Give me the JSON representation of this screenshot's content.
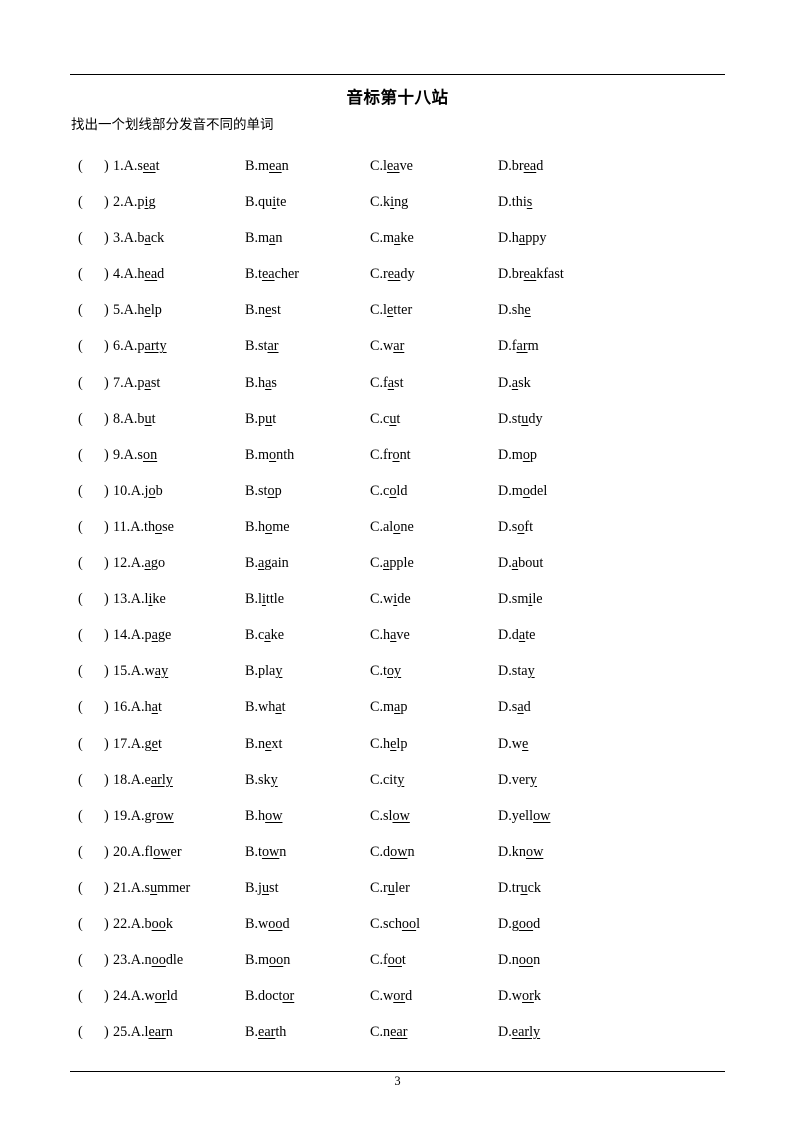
{
  "document": {
    "title": "音标第十八站",
    "instruction": "找出一个划线部分发音不同的单词",
    "page_number": "3",
    "paren_open": "(",
    "paren_close": ")"
  },
  "questions": [
    {
      "number": "1.",
      "options": [
        {
          "letter": "A.",
          "pre": "s",
          "mid": "ea",
          "post": "t"
        },
        {
          "letter": "B.",
          "pre": "m",
          "mid": "ea",
          "post": "n"
        },
        {
          "letter": "C.",
          "pre": "l",
          "mid": "ea",
          "post": "ve"
        },
        {
          "letter": "D.",
          "pre": "br",
          "mid": "ea",
          "post": "d"
        }
      ]
    },
    {
      "number": "2.",
      "options": [
        {
          "letter": "A.",
          "pre": "p",
          "mid": "i",
          "post": "g"
        },
        {
          "letter": "B.",
          "pre": "qu",
          "mid": "i",
          "post": "te"
        },
        {
          "letter": "C.",
          "pre": "k",
          "mid": "i",
          "post": "ng"
        },
        {
          "letter": "D.",
          "pre": "thi",
          "mid": "s",
          "post": ""
        }
      ]
    },
    {
      "number": "3.",
      "options": [
        {
          "letter": "A.",
          "pre": "b",
          "mid": "a",
          "post": "ck"
        },
        {
          "letter": "B.",
          "pre": "m",
          "mid": "a",
          "post": "n"
        },
        {
          "letter": "C.",
          "pre": "m",
          "mid": "a",
          "post": "ke"
        },
        {
          "letter": "D.",
          "pre": "h",
          "mid": "a",
          "post": "ppy"
        }
      ]
    },
    {
      "number": "4.",
      "options": [
        {
          "letter": "A.",
          "pre": "h",
          "mid": "ea",
          "post": "d"
        },
        {
          "letter": "B.",
          "pre": "t",
          "mid": "ea",
          "post": "cher"
        },
        {
          "letter": "C.",
          "pre": "r",
          "mid": "ea",
          "post": "dy"
        },
        {
          "letter": "D.",
          "pre": "br",
          "mid": "ea",
          "post": "kfast"
        }
      ]
    },
    {
      "number": "5.",
      "options": [
        {
          "letter": "A.",
          "pre": "h",
          "mid": "e",
          "post": "lp"
        },
        {
          "letter": "B.",
          "pre": "n",
          "mid": "e",
          "post": "st"
        },
        {
          "letter": "C.",
          "pre": "l",
          "mid": "e",
          "post": "tter"
        },
        {
          "letter": "D.",
          "pre": "sh",
          "mid": "e",
          "post": ""
        }
      ]
    },
    {
      "number": "6.",
      "options": [
        {
          "letter": "A.",
          "pre": "p",
          "mid": "arty",
          "post": ""
        },
        {
          "letter": "B.",
          "pre": "st",
          "mid": "ar",
          "post": ""
        },
        {
          "letter": "C.",
          "pre": "w",
          "mid": "ar",
          "post": ""
        },
        {
          "letter": "D.",
          "pre": "f",
          "mid": "ar",
          "post": "m"
        }
      ]
    },
    {
      "number": "7.",
      "options": [
        {
          "letter": "A.",
          "pre": "p",
          "mid": "a",
          "post": "st"
        },
        {
          "letter": "B.",
          "pre": "h",
          "mid": "a",
          "post": "s"
        },
        {
          "letter": "C.",
          "pre": "f",
          "mid": "a",
          "post": "st"
        },
        {
          "letter": "D.",
          "pre": "",
          "mid": "a",
          "post": "sk"
        }
      ]
    },
    {
      "number": "8.",
      "options": [
        {
          "letter": "A.",
          "pre": "b",
          "mid": "u",
          "post": "t"
        },
        {
          "letter": "B.",
          "pre": "p",
          "mid": "u",
          "post": "t"
        },
        {
          "letter": "C.",
          "pre": "c",
          "mid": "u",
          "post": "t"
        },
        {
          "letter": "D.",
          "pre": "st",
          "mid": "u",
          "post": "dy"
        }
      ]
    },
    {
      "number": "9.",
      "options": [
        {
          "letter": "A.",
          "pre": "s",
          "mid": "on",
          "post": ""
        },
        {
          "letter": "B.",
          "pre": "m",
          "mid": "o",
          "post": "nth"
        },
        {
          "letter": "C.",
          "pre": "fr",
          "mid": "o",
          "post": "nt"
        },
        {
          "letter": "D.",
          "pre": "m",
          "mid": "o",
          "post": "p"
        }
      ]
    },
    {
      "number": "10.",
      "options": [
        {
          "letter": "A.",
          "pre": "j",
          "mid": "o",
          "post": "b"
        },
        {
          "letter": "B.",
          "pre": "st",
          "mid": "o",
          "post": "p"
        },
        {
          "letter": "C.",
          "pre": "c",
          "mid": "o",
          "post": "ld"
        },
        {
          "letter": "D.",
          "pre": "m",
          "mid": "o",
          "post": "del"
        }
      ]
    },
    {
      "number": "11.",
      "options": [
        {
          "letter": "A.",
          "pre": "th",
          "mid": "o",
          "post": "se"
        },
        {
          "letter": "B.",
          "pre": "h",
          "mid": "o",
          "post": "me"
        },
        {
          "letter": "C.",
          "pre": "al",
          "mid": "o",
          "post": "ne"
        },
        {
          "letter": "D.",
          "pre": "s",
          "mid": "o",
          "post": "ft"
        }
      ]
    },
    {
      "number": "12.",
      "options": [
        {
          "letter": "A.",
          "pre": "",
          "mid": "a",
          "post": "go"
        },
        {
          "letter": "B.",
          "pre": "",
          "mid": "a",
          "post": "gain"
        },
        {
          "letter": "C.",
          "pre": "",
          "mid": "a",
          "post": "pple"
        },
        {
          "letter": "D.",
          "pre": "",
          "mid": "a",
          "post": "bout"
        }
      ]
    },
    {
      "number": "13.",
      "options": [
        {
          "letter": "A.",
          "pre": "l",
          "mid": "i",
          "post": "ke"
        },
        {
          "letter": "B.",
          "pre": "l",
          "mid": "i",
          "post": "ttle"
        },
        {
          "letter": "C.",
          "pre": "w",
          "mid": "i",
          "post": "de"
        },
        {
          "letter": "D.",
          "pre": "sm",
          "mid": "i",
          "post": "le"
        }
      ]
    },
    {
      "number": "14.",
      "options": [
        {
          "letter": "A.",
          "pre": "p",
          "mid": "a",
          "post": "ge"
        },
        {
          "letter": "B.",
          "pre": "c",
          "mid": "a",
          "post": "ke"
        },
        {
          "letter": "C.",
          "pre": "h",
          "mid": "a",
          "post": "ve"
        },
        {
          "letter": "D.",
          "pre": "d",
          "mid": "a",
          "post": "te"
        }
      ]
    },
    {
      "number": "15.",
      "options": [
        {
          "letter": "A.",
          "pre": "w",
          "mid": "ay",
          "post": ""
        },
        {
          "letter": "B.",
          "pre": "pla",
          "mid": "y",
          "post": ""
        },
        {
          "letter": "C.",
          "pre": "t",
          "mid": "oy",
          "post": ""
        },
        {
          "letter": "D.",
          "pre": "sta",
          "mid": "y",
          "post": ""
        }
      ]
    },
    {
      "number": "16.",
      "options": [
        {
          "letter": "A.",
          "pre": "h",
          "mid": "a",
          "post": "t"
        },
        {
          "letter": "B.",
          "pre": "wh",
          "mid": "a",
          "post": "t"
        },
        {
          "letter": "C.",
          "pre": "m",
          "mid": "a",
          "post": "p"
        },
        {
          "letter": "D.",
          "pre": "s",
          "mid": "a",
          "post": "d"
        }
      ]
    },
    {
      "number": "17.",
      "options": [
        {
          "letter": "A.",
          "pre": "g",
          "mid": "e",
          "post": "t"
        },
        {
          "letter": "B.",
          "pre": "n",
          "mid": "e",
          "post": "xt"
        },
        {
          "letter": "C.",
          "pre": "h",
          "mid": "e",
          "post": "lp"
        },
        {
          "letter": "D.",
          "pre": "w",
          "mid": "e",
          "post": ""
        }
      ]
    },
    {
      "number": "18.",
      "options": [
        {
          "letter": "A.",
          "pre": "e",
          "mid": "arly",
          "post": ""
        },
        {
          "letter": "B.",
          "pre": "sk",
          "mid": "y",
          "post": ""
        },
        {
          "letter": "C.",
          "pre": "cit",
          "mid": "y",
          "post": ""
        },
        {
          "letter": "D.",
          "pre": "ver",
          "mid": "y",
          "post": ""
        }
      ]
    },
    {
      "number": "19.",
      "options": [
        {
          "letter": "A.",
          "pre": "gr",
          "mid": "ow",
          "post": ""
        },
        {
          "letter": "B.",
          "pre": "h",
          "mid": "ow",
          "post": ""
        },
        {
          "letter": "C.",
          "pre": "sl",
          "mid": "ow",
          "post": ""
        },
        {
          "letter": "D.",
          "pre": "yell",
          "mid": "ow",
          "post": ""
        }
      ]
    },
    {
      "number": "20.",
      "options": [
        {
          "letter": "A.",
          "pre": "fl",
          "mid": "ow",
          "post": "er"
        },
        {
          "letter": "B.",
          "pre": "t",
          "mid": "ow",
          "post": "n"
        },
        {
          "letter": "C.",
          "pre": "d",
          "mid": "ow",
          "post": "n"
        },
        {
          "letter": "D.",
          "pre": "kn",
          "mid": "ow",
          "post": ""
        }
      ]
    },
    {
      "number": "21.",
      "options": [
        {
          "letter": "A.",
          "pre": "s",
          "mid": "u",
          "post": "mmer"
        },
        {
          "letter": "B.",
          "pre": "j",
          "mid": "u",
          "post": "st"
        },
        {
          "letter": "C.",
          "pre": "r",
          "mid": "u",
          "post": "ler"
        },
        {
          "letter": "D.",
          "pre": "tr",
          "mid": "u",
          "post": "ck"
        }
      ]
    },
    {
      "number": "22.",
      "options": [
        {
          "letter": "A.",
          "pre": "b",
          "mid": "oo",
          "post": "k"
        },
        {
          "letter": "B.",
          "pre": "w",
          "mid": "oo",
          "post": "d"
        },
        {
          "letter": "C.",
          "pre": "sch",
          "mid": "oo",
          "post": "l"
        },
        {
          "letter": "D.",
          "pre": "g",
          "mid": "oo",
          "post": "d"
        }
      ]
    },
    {
      "number": "23.",
      "options": [
        {
          "letter": "A.",
          "pre": "n",
          "mid": "oo",
          "post": "dle"
        },
        {
          "letter": "B.",
          "pre": "m",
          "mid": "oo",
          "post": "n"
        },
        {
          "letter": "C.",
          "pre": "f",
          "mid": "oo",
          "post": "t"
        },
        {
          "letter": "D.",
          "pre": "n",
          "mid": "oo",
          "post": "n"
        }
      ]
    },
    {
      "number": "24.",
      "options": [
        {
          "letter": "A.",
          "pre": "w",
          "mid": "or",
          "post": "ld"
        },
        {
          "letter": "B.",
          "pre": "doct",
          "mid": "or",
          "post": ""
        },
        {
          "letter": "C.",
          "pre": "w",
          "mid": "or",
          "post": "d"
        },
        {
          "letter": "D.",
          "pre": "w",
          "mid": "or",
          "post": "k"
        }
      ]
    },
    {
      "number": "25.",
      "options": [
        {
          "letter": "A.",
          "pre": "l",
          "mid": "ear",
          "post": "n"
        },
        {
          "letter": "B.",
          "pre": "",
          "mid": "ear",
          "post": "th"
        },
        {
          "letter": "C.",
          "pre": "n",
          "mid": "ear",
          "post": ""
        },
        {
          "letter": "D.",
          "pre": "",
          "mid": "early",
          "post": ""
        }
      ]
    }
  ]
}
